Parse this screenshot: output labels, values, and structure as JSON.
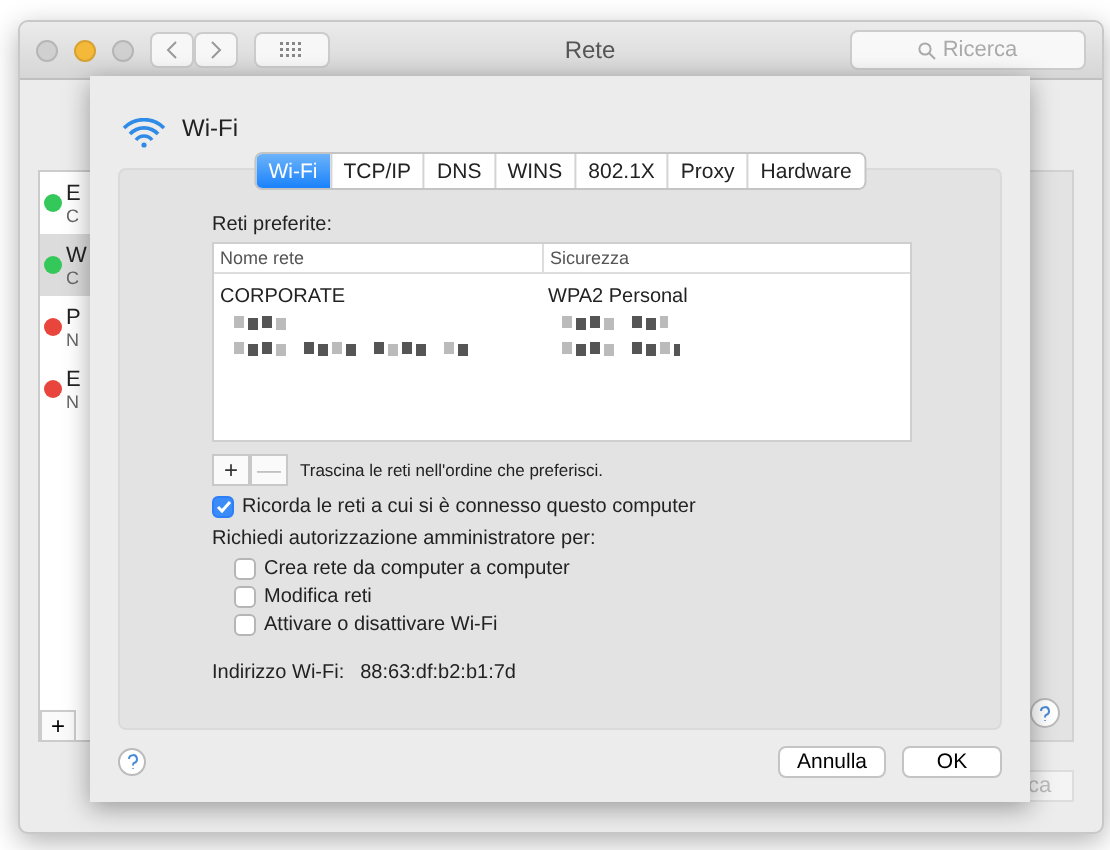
{
  "window": {
    "title": "Rete",
    "search": {
      "placeholder": "Ricerca"
    }
  },
  "sidebar": {
    "items": [
      {
        "name": "E",
        "subtitle": "C",
        "color": "#34c759",
        "selected": false
      },
      {
        "name": "W",
        "subtitle": "C",
        "color": "#34c759",
        "selected": true
      },
      {
        "name": "P",
        "subtitle": "N",
        "color": "#e8453c",
        "selected": false
      },
      {
        "name": "E",
        "subtitle": "N",
        "color": "#e8453c",
        "selected": false
      }
    ]
  },
  "sidebar_add_button": "+",
  "background_button": {
    "label": "ca"
  },
  "sheet": {
    "title": "Wi-Fi",
    "tabs": [
      {
        "label": "Wi-Fi",
        "selected": true
      },
      {
        "label": "TCP/IP",
        "selected": false
      },
      {
        "label": "DNS",
        "selected": false
      },
      {
        "label": "WINS",
        "selected": false
      },
      {
        "label": "802.1X",
        "selected": false
      },
      {
        "label": "Proxy",
        "selected": false
      },
      {
        "label": "Hardware",
        "selected": false
      }
    ],
    "preferred_label": "Reti preferite:",
    "table": {
      "columns": [
        "Nome rete",
        "Sicurezza"
      ],
      "rows": [
        {
          "kind": "text",
          "cells": [
            "CORPORATE",
            "WPA2 Personal"
          ]
        },
        {
          "kind": "redacted"
        },
        {
          "kind": "redacted"
        }
      ]
    },
    "list_buttons": [
      "+",
      "—"
    ],
    "list_hint": "Trascina le reti nell'ordine che preferisci.",
    "remember": {
      "label": "Ricorda le reti a cui si è connesso questo computer",
      "checked": true
    },
    "admin_label": "Richiedi autorizzazione amministratore per:",
    "admin_options": [
      {
        "label": "Crea rete da computer a computer",
        "checked": false
      },
      {
        "label": "Modifica reti",
        "checked": false
      },
      {
        "label": "Attivare o disattivare Wi-Fi",
        "checked": false
      }
    ],
    "address_label": "Indirizzo Wi-Fi:",
    "address": "88:63:df:b2:b1:7d",
    "buttons": [
      "Annulla",
      "OK"
    ]
  }
}
